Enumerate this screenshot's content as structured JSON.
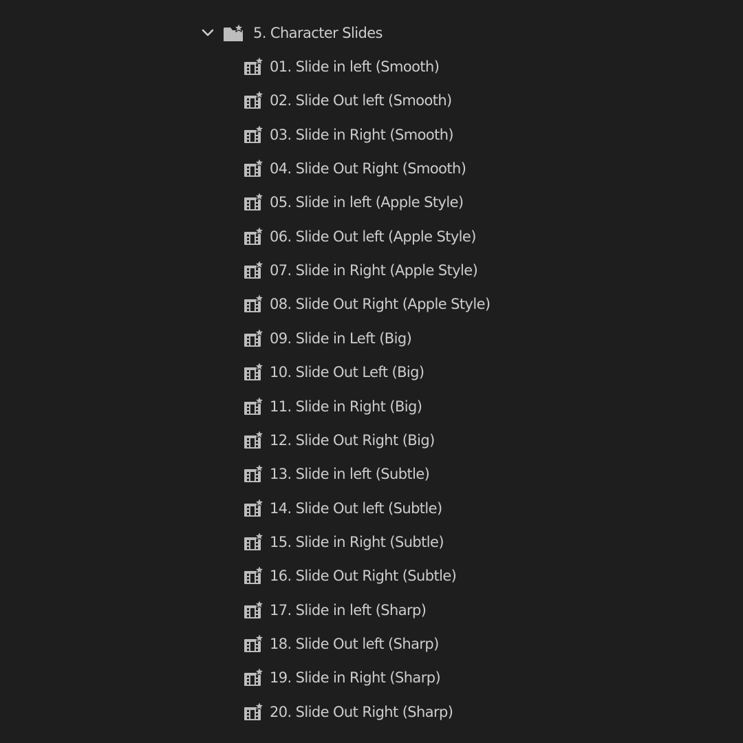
{
  "panel": {
    "folder": {
      "label": "5. Character Slides",
      "expanded": true,
      "icon": "preset-folder-icon"
    },
    "items_icon": "motion-preset-icon",
    "items": [
      {
        "label": "01. Slide in left (Smooth)"
      },
      {
        "label": "02. Slide Out left (Smooth)"
      },
      {
        "label": "03. Slide in Right (Smooth)"
      },
      {
        "label": "04. Slide Out Right (Smooth)"
      },
      {
        "label": "05. Slide in left (Apple Style)"
      },
      {
        "label": "06. Slide Out left (Apple Style)"
      },
      {
        "label": "07. Slide in Right (Apple Style)"
      },
      {
        "label": "08. Slide Out Right (Apple Style)"
      },
      {
        "label": "09. Slide in Left (Big)"
      },
      {
        "label": "10. Slide Out Left (Big)"
      },
      {
        "label": "11. Slide in Right (Big)"
      },
      {
        "label": "12. Slide Out Right (Big)"
      },
      {
        "label": "13. Slide in left (Subtle)"
      },
      {
        "label": "14. Slide Out left (Subtle)"
      },
      {
        "label": "15. Slide in Right (Subtle)"
      },
      {
        "label": "16. Slide Out Right (Subtle)"
      },
      {
        "label": "17. Slide in left (Sharp)"
      },
      {
        "label": "18. Slide Out left (Sharp)"
      },
      {
        "label": "19. Slide in Right (Sharp)"
      },
      {
        "label": "20. Slide Out Right (Sharp)"
      }
    ]
  },
  "colors": {
    "background": "#1e1e1e",
    "text": "#cdcdcd",
    "icon": "#bdbdbd"
  }
}
